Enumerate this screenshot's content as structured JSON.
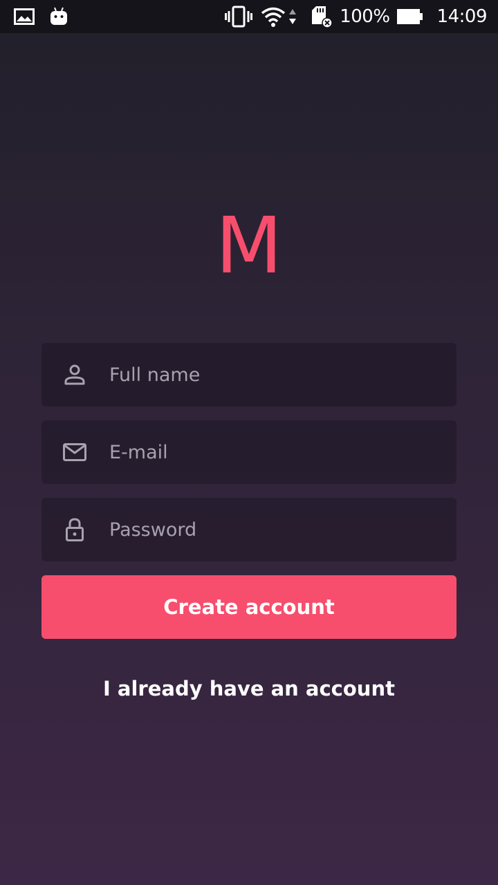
{
  "status_bar": {
    "battery": "100%",
    "time": "14:09",
    "left_icons": [
      "image-icon",
      "android-icon"
    ],
    "right_icons": [
      "vibrate-icon",
      "wifi-icon",
      "data-arrows-icon",
      "sd-card-error-icon",
      "battery-icon"
    ]
  },
  "logo": {
    "text": "M",
    "color": "#f74e6d"
  },
  "form": {
    "full_name": {
      "placeholder": "Full name",
      "value": "",
      "icon": "person-icon"
    },
    "email": {
      "placeholder": "E-mail",
      "value": "",
      "icon": "mail-icon"
    },
    "password": {
      "placeholder": "Password",
      "value": "",
      "icon": "lock-icon"
    }
  },
  "actions": {
    "create_label": "Create account",
    "signin_label": "I already have an account"
  },
  "colors": {
    "accent": "#f74e6d",
    "background_top": "#211f2a",
    "background_bottom": "#3d2746",
    "placeholder": "#a8a2ae"
  }
}
